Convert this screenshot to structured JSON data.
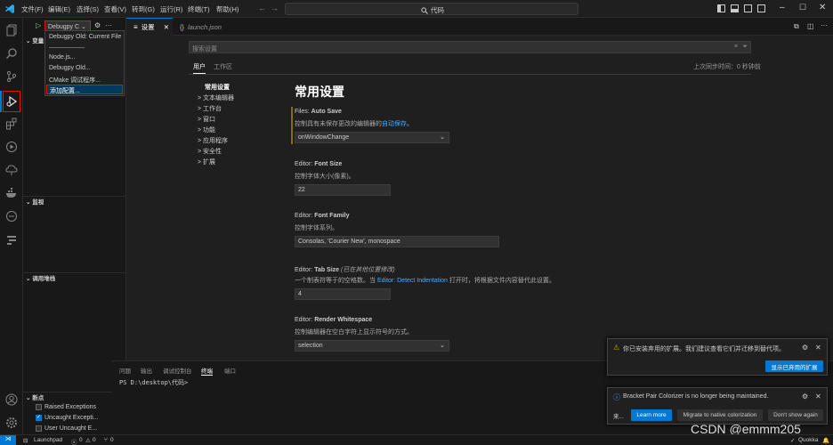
{
  "menu": [
    "文件(F)",
    "编辑(E)",
    "选择(S)",
    "查看(V)",
    "转到(G)",
    "运行(R)",
    "终端(T)",
    "帮助(H)"
  ],
  "search_box": "代码",
  "sidebar": {
    "sections": [
      "变量",
      "监视",
      "调用堆栈",
      "断点"
    ],
    "run_config": "Debugpy C",
    "breakpoints": [
      {
        "label": "Raised Exceptions",
        "checked": false
      },
      {
        "label": "Uncaught Excepti...",
        "checked": true
      },
      {
        "label": "User Uncaught E...",
        "checked": false
      }
    ]
  },
  "dropdown": [
    "Debugpy Old: Current File",
    "",
    "Node.js...",
    "Debugpy Old...",
    "CMake 调试程序...",
    "添加配置..."
  ],
  "tabs": [
    {
      "label": "设置",
      "active": true
    },
    {
      "label": "launch.json",
      "active": false
    }
  ],
  "settings": {
    "search_placeholder": "搜索设置",
    "scope_tabs": [
      "用户",
      "工作区"
    ],
    "last_sync": "上次同步时间：0 秒钟前",
    "toc": [
      "常用设置",
      "文本编辑器",
      "工作台",
      "窗口",
      "功能",
      "应用程序",
      "安全性",
      "扩展"
    ],
    "heading": "常用设置",
    "items": [
      {
        "cat": "Files: ",
        "name": "Auto Save",
        "desc": "控制具有未保存更改的编辑器的",
        "link": "自动保存",
        "desc_end": "。",
        "value": "onWindowChange",
        "type": "select"
      },
      {
        "cat": "Editor: ",
        "name": "Font Size",
        "desc": "控制字体大小(像素)。",
        "value": "22",
        "type": "input"
      },
      {
        "cat": "Editor: ",
        "name": "Font Family",
        "desc": "控制字体系列。",
        "value": "Consolas, 'Courier New', monospace",
        "type": "input"
      },
      {
        "cat": "Editor: ",
        "name": "Tab Size",
        "modified": "(已在其他位置修改)",
        "desc": "一个制表符等于的空格数。当",
        "link": "Editor: Detect Indentation",
        "desc_end": "打开时，将根据文件内容替代此设置。",
        "value": "4",
        "type": "input"
      },
      {
        "cat": "Editor: ",
        "name": "Render Whitespace",
        "desc": "控制编辑器在空白字符上显示符号的方式。",
        "value": "selection",
        "type": "select"
      }
    ]
  },
  "panel": {
    "tabs": [
      "问题",
      "输出",
      "调试控制台",
      "终端",
      "端口"
    ],
    "active_tab": "终端",
    "terminal_line": "PS D:\\desktop\\代码>"
  },
  "notifications": [
    {
      "text": "你已安装弃用的扩展。我们建议查看它们并迁移到替代项。",
      "buttons": [
        "显示已弃用的扩展"
      ]
    },
    {
      "text": "Bracket Pair Colorizer is no longer being maintained.",
      "more": "来...",
      "buttons": [
        "Learn more",
        "Migrate to native colorization",
        "Don't show again"
      ]
    }
  ],
  "status": {
    "launchpad": "Launchpad",
    "errors": "0",
    "warnings": "0",
    "ports": "0",
    "quokka": "Quokka"
  },
  "watermark": "CSDN @emmm205",
  "colors": {
    "accent": "#0078d4",
    "highlight": "#e51400",
    "link": "#4daafc"
  }
}
